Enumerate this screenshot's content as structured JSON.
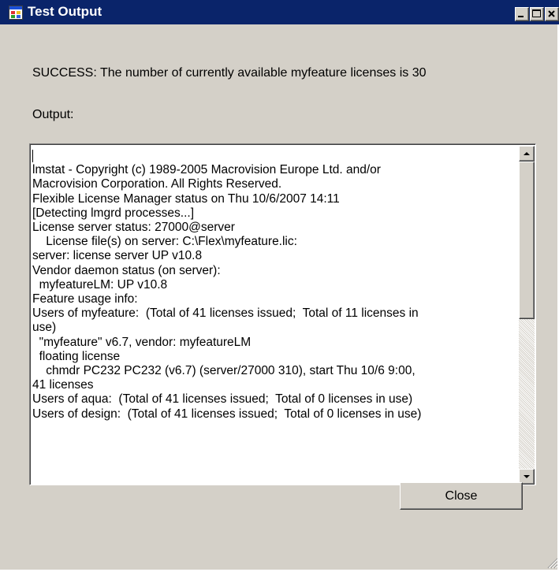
{
  "window": {
    "title": "Test Output"
  },
  "status_text": "SUCCESS: The number of currently available myfeature licenses is 30",
  "output_label": "Output:",
  "output_lines": [
    "lmstat - Copyright (c) 1989-2005 Macrovision Europe Ltd. and/or",
    "Macrovision Corporation. All Rights Reserved.",
    "Flexible License Manager status on Thu 10/6/2007 14:11",
    "[Detecting lmgrd processes...]",
    "License server status: 27000@server",
    "    License file(s) on server: C:\\Flex\\myfeature.lic:",
    "server: license server UP v10.8",
    "Vendor daemon status (on server):",
    "  myfeatureLM: UP v10.8",
    "Feature usage info:",
    "Users of myfeature:  (Total of 41 licenses issued;  Total of 11 licenses in",
    "use)",
    "  \"myfeature\" v6.7, vendor: myfeatureLM",
    "  floating license",
    "    chmdr PC232 PC232 (v6.7) (server/27000 310), start Thu 10/6 9:00,",
    "41 licenses",
    "Users of aqua:  (Total of 41 licenses issued;  Total of 0 licenses in use)",
    "Users of design:  (Total of 41 licenses issued;  Total of 0 licenses in use)"
  ],
  "buttons": {
    "close_label": "Close"
  },
  "colors": {
    "titlebar": "#0a246a",
    "face": "#d4d0c8"
  },
  "icons": [
    "app-form-icon",
    "minimize-icon",
    "maximize-icon",
    "close-icon",
    "scroll-up-icon",
    "scroll-down-icon",
    "size-grip-icon"
  ]
}
